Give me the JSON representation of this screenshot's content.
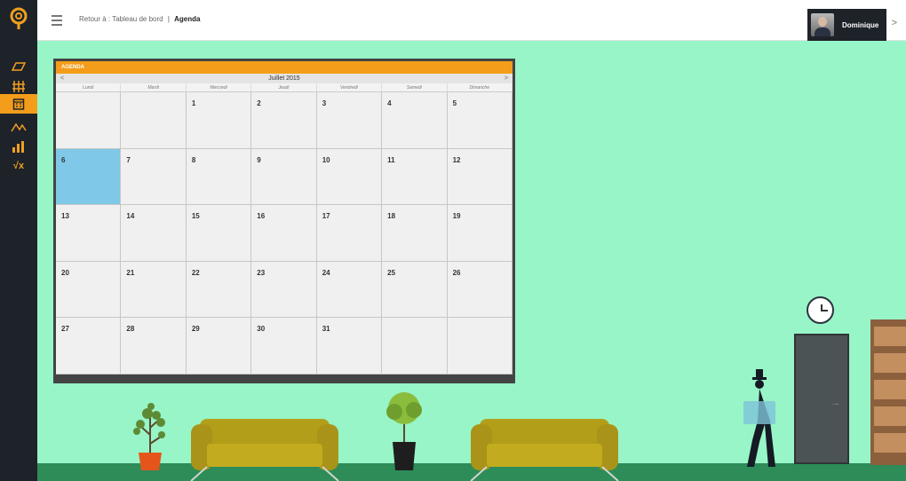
{
  "topbar": {
    "breadcrumb_back": "Retour à : Tableau de bord",
    "breadcrumb_sep": "|",
    "breadcrumb_current": "Agenda",
    "user_name": "Dominique",
    "user_caret": ">"
  },
  "sidebar": {
    "items": [
      {
        "icon": "book-icon",
        "glyph": "▱"
      },
      {
        "icon": "fence-icon",
        "glyph": "卌"
      },
      {
        "icon": "calendar-icon",
        "glyph": "▦",
        "active": true
      },
      {
        "icon": "line-chart-icon",
        "glyph": "⋀⋁"
      },
      {
        "icon": "bar-chart-icon",
        "glyph": "▁▃▅"
      },
      {
        "icon": "sqrt-icon",
        "glyph": "√x"
      }
    ]
  },
  "agenda": {
    "header": "AGENDA",
    "month": "Juillet 2015",
    "prev": "<",
    "next": ">",
    "weekdays": [
      "Lundi",
      "Mardi",
      "Mercredi",
      "Jeudi",
      "Vendredi",
      "Samedi",
      "Dimanche"
    ],
    "weeks": [
      [
        "",
        "",
        "1",
        "2",
        "3",
        "4",
        "5"
      ],
      [
        "6",
        "7",
        "8",
        "9",
        "10",
        "11",
        "12"
      ],
      [
        "13",
        "14",
        "15",
        "16",
        "17",
        "18",
        "19"
      ],
      [
        "20",
        "21",
        "22",
        "23",
        "24",
        "25",
        "26"
      ],
      [
        "27",
        "28",
        "29",
        "30",
        "31",
        "",
        ""
      ]
    ],
    "today": "6"
  },
  "colors": {
    "accent": "#f49d1a",
    "background": "#97f5c7",
    "today_cell": "#80c8e7",
    "sidebar": "#1e2229"
  }
}
